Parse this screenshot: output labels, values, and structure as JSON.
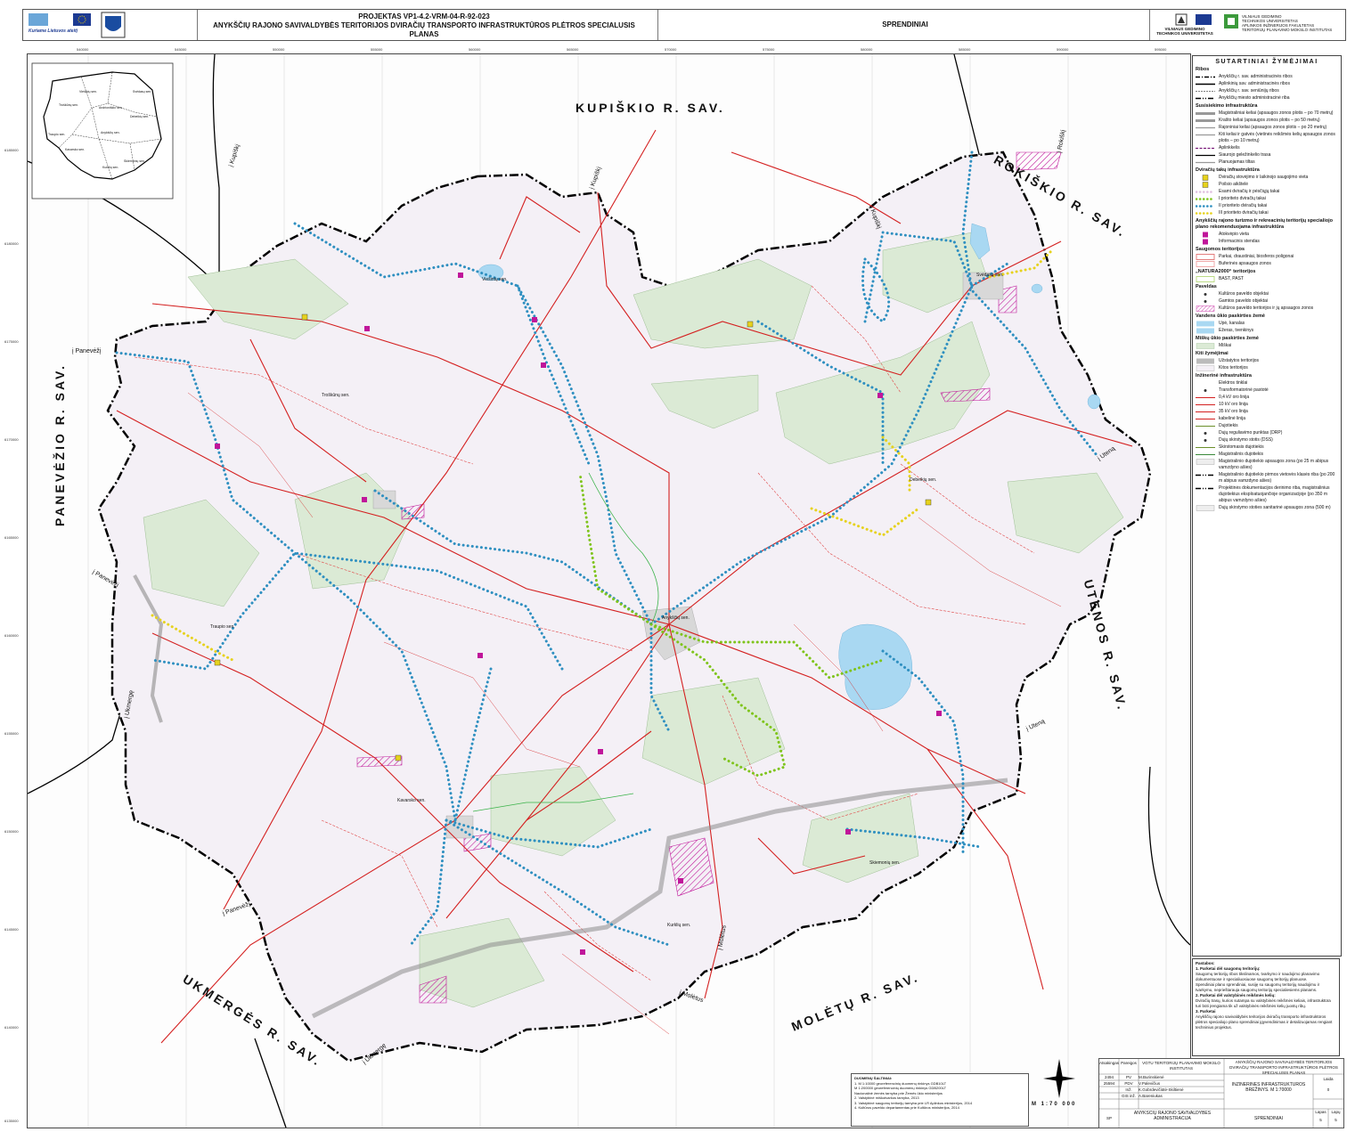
{
  "header": {
    "project_line": "PROJEKTAS VP1-4.2-VRM-04-R-92-023",
    "title_line": "ANYKŠČIŲ RAJONO SAVIVALDYBĖS TERITORIJOS DVIRAČIŲ TRANSPORTO INFRASTRUKTŪROS PLĖTROS SPECIALUSIS PLANAS",
    "section": "SPRENDINIAI",
    "slogan": "Kuriame Lietuvos ateitį",
    "university": "VILNIAUS GEDIMINO TECHNIKOS UNIVERSITETAS",
    "institute_lines": [
      "VILNIAUS GEDIMINO",
      "TECHNIKOS UNIVERSITETAS",
      "APLINKOS INŽINERIJOS FAKULTETAS",
      "TERITORIJŲ PLANAVIMO MOKSLO INSTITUTAS"
    ]
  },
  "map": {
    "neighbours": {
      "kupiskis": "KUPIŠKIO R. SAV.",
      "rokiskis": "ROKIŠKIO R. SAV.",
      "panevezys": "PANEVĖŽIO R. SAV.",
      "utena": "UTENOS R. SAV.",
      "moletai": "MOLĖTŲ R. SAV.",
      "ukmerge": "UKMERGĖS R. SAV."
    },
    "directions": {
      "kupiskis1": "į Kupiškį",
      "kupiskis2": "į Kupiškį",
      "kupiskis3": "į Kupiškį",
      "rokiskis": "į Rokiškį",
      "paneveza1": "į Panevėžį",
      "paneveza2": "į Panevėžį",
      "paneveza3": "į Panevėžį",
      "utena1": "į Uteną",
      "utena2": "į Uteną",
      "moletai1": "į Molėtus",
      "moletai2": "į Molėtus",
      "ukmerge1": "į Ukmergę",
      "ukmerge2": "į Ukmergę"
    },
    "places": {
      "viesintos": "Viešintų sen.",
      "troskunai": "Troškūnų sen.",
      "svedasai": "Svėdasų sen.",
      "debeikiai": "Debeikių sen.",
      "anyksciai": "Anykščių sen.",
      "traupis": "Traupio sen.",
      "kavarskas": "Kavarsko sen.",
      "skiemonys": "Skiemonių sen.",
      "kurkliai": "Kurklių sen."
    },
    "inset_places": {
      "viesintos": "Viešintų sen.",
      "svedasai": "Svėdasų sen.",
      "troskunai": "Troškūnų sen.",
      "andrioniskis": "Andrioniškio sen.",
      "debeikiai": "Debeikių sen.",
      "traupis": "Traupio sen.",
      "anyksciai": "Anykščių sen.",
      "kavarskas": "Kavarsko sen.",
      "skiemonys": "Skiemonių sen.",
      "kurkliai": "Kurklių sen."
    },
    "coords_top": [
      "540000",
      "545000",
      "550000",
      "555000",
      "560000",
      "565000",
      "570000",
      "575000",
      "580000",
      "585000",
      "590000",
      "595000"
    ],
    "coords_left": [
      "6185000",
      "6180000",
      "6175000",
      "6170000",
      "6165000",
      "6160000",
      "6155000",
      "6150000",
      "6145000",
      "6140000",
      "6135000"
    ]
  },
  "legend": {
    "title": "SUTARTINIAI ŽYMĖJIMAI",
    "sections": [
      {
        "name": "Ribos",
        "items": [
          "Anykščių r. sav. administracinės ribos",
          "Aplinkinių sav. administracinės ribos",
          "Anykščių r. sav. seniūnijų ribos",
          "Anykščių miesto administracinė riba"
        ]
      },
      {
        "name": "Susisiekimo infrastruktūra",
        "items": [
          "Magistraliniai keliai (apsaugos zonos plotis – po 70 metrų)",
          "Krašto keliai (apsaugos zonos plotis – po 50 metrų)",
          "Rajoniniai keliai (apsaugos zonos plotis – po 20 metrų)",
          "Kiti keliai ir gatvės (vietinės reikšmės kelių apsaugos zonos plotis – po 10 metrų)",
          "Aplinkkelis",
          "Siaurojo geležinkelio trasa",
          "Planuojamas tiltas"
        ]
      },
      {
        "name": "Dviračių takų infrastruktūra",
        "items": [
          "Dviračių stovėjimo ir laikinojo saugojimo vieta",
          "Poilsio aikštelė",
          "Esami dviračių ir pėsčiųjų takai",
          "I prioriteto dviračių takai",
          "II prioriteto dviračių takai",
          "III prioriteto dviračių takai"
        ]
      },
      {
        "name": "Anykščių rajono turizmo ir rekreacinių teritorijų specialiojo plano rekomenduojama infrastruktūra",
        "items": [
          "Atokvėpio vieta",
          "Informacinis stendas"
        ]
      },
      {
        "name": "Saugomos teritorijos",
        "items": [
          "Parkai, draustiniai, biosferos poligonai",
          "Buferinės apsaugos zonos"
        ]
      },
      {
        "name": "„NATURA2000“ teritorijos",
        "items": [
          "BAST, PAST"
        ]
      },
      {
        "name": "Paveldas",
        "items": [
          "Kultūros paveldo objektai",
          "Gamtos paveldo objektai",
          "Kultūros paveldo teritorijos ir jų apsaugos zonos"
        ]
      },
      {
        "name": "Vandens ūkio paskirties žemė",
        "items": [
          "Upė, kanalas",
          "Ežeras, tvenkinys"
        ]
      },
      {
        "name": "Miškų ūkio paskirties žemė",
        "items": [
          "Miškai"
        ]
      },
      {
        "name": "Kiti žymėjimai",
        "items": [
          "Užstatytos teritorijos",
          "Kitos teritorijos"
        ]
      },
      {
        "name": "Inžinerinė infrastruktūra",
        "items": [
          "Elektros tinklai",
          "Transformatorinė pastotė",
          "0,4 kV oro linija",
          "10 kV oro linija",
          "35 kV oro linija",
          "kabelinė linija",
          "Dujotiekis",
          "Dujų reguliavimo punktas (DRP)",
          "Dujų skirstymo stotis (DSS)",
          "Skirstomasis dujotiekis",
          "Magistralinis dujotiekis",
          "Magistralinio dujotiekio apsaugos zona (po 25 m abipus vamzdyno ašies)",
          "Magistralinio dujotiekio pirmos vietovės klasės riba (po 200 m abipus vamzdyno ašies)",
          "Projektinės dokumentacijos derinimo riba, magistralinius dujotiekius eksploatuojančioje organizacijoje (po 350 m abipus vamzdyno ašies)",
          "Dujų skirstymo stoties sanitarinė apsaugos zona (500 m)"
        ]
      }
    ]
  },
  "notes": {
    "title": "Pastabos:",
    "lines": [
      "1. Parketai dėl saugomų teritorijų:",
      "Saugomų teritorijų ribos tikslinamos, tvarkymo ir naudojimo planavimo dokumentuose ir specialiuosiuose saugomų teritorijų planuose.",
      "Spendiniai plano sprendiniai, susiję su saugomų teritorijų naudojimu ir tvarkymu, neprieštarauja saugomų teritorijų specialiesiems planams.",
      "2. Parketai dėl valstybinės reikšmės kelių:",
      "Dviračių trasų, kurios sutampa su valstybinės reikšmės keliais, infrastruktūra turi būti įrengiama tik už valstybinės reikšmės kelių juostų ribų.",
      "3. Parketai",
      "Anykščių rajono savivaldybės teritorijos dviračių transporto infrastruktūros plėtros specialiojo plano sprendiniai įgyvendinimas ir detalizuojamas rengiant techninius projektus."
    ]
  },
  "sources": {
    "title": "DUOMENŲ ŠALTINIAI:",
    "lines": [
      "1. M 1:10000 georeferencinių duomenų rinkinys GDB10LT",
      "M 1:200000 georeferencinių duomenų rinkinys GDB200LT",
      "Nacionalinė žemės tarnyba prie Žemės ūkio ministerijos",
      "2. Valstybinė miškotvarkos tarnyba, 2013",
      "3. Valstybinė saugomų teritorijų tarnyba prie LR Aplinkos ministerijos, 2014",
      "4. Kultūros paveldo departamentas prie Kultūros ministerijos, 2014"
    ]
  },
  "titleblock": {
    "cols": [
      "Atsakingas",
      "Pareigos"
    ],
    "institute": "VGTU TERITORIJŲ PLANAVIMO MOKSLO INSTITUTAS",
    "plan_name": "ANYKŠČIŲ RAJONO SAVIVALDYBĖS TERITORIJOS DVIRAČIŲ TRANSPORTO INFRASTRUKTŪROS PLĖTROS SPECIALUSIS PLANAS",
    "drawing_name": "INŽINERINĖS INFRASTRUKTŪROS BRĖŽINYS. M 1:70000",
    "sheet_label": "Laida",
    "sheet_value": "0",
    "rows": [
      {
        "code": "2494",
        "role": "PV",
        "name": "M.Burinskienė"
      },
      {
        "code": "25594",
        "role": "PDV",
        "name": "V.Palevičius"
      },
      {
        "code": "",
        "role": "Inž.",
        "name": "K.Gobrdevičiūtė-Skiltienė"
      },
      {
        "code": "",
        "role": "GIS inž.",
        "name": "A.Bareniukas"
      }
    ],
    "stage": "SP",
    "client": "ANYKŠČIŲ RAJONO SAVIVALDYBĖS ADMINISTRACIJA",
    "section": "SPRENDINIAI",
    "sheet_no_label": "Lapas",
    "sheet_no": "5",
    "sheets_label": "Lapų",
    "sheets": "5"
  },
  "scale": "M 1:70 000",
  "colors": {
    "border": "#000000",
    "roads": "#d42020",
    "priority1": "#7fc41c",
    "priority2": "#2e8fc0",
    "priority3": "#e6d21e",
    "forest": "#dbead5",
    "water": "#a9d8f2",
    "heritage": "#c0169a"
  }
}
